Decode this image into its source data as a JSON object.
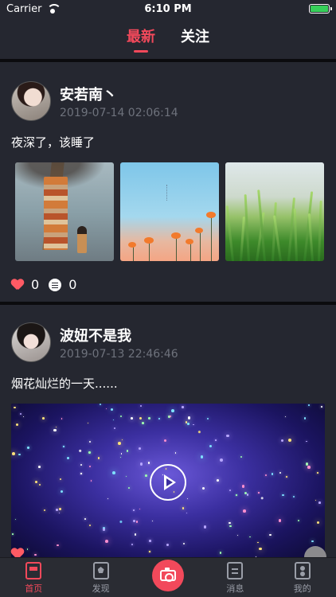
{
  "status_bar": {
    "carrier": "Carrier",
    "time": "6:10 PM"
  },
  "tabs": [
    {
      "label": "最新",
      "active": true
    },
    {
      "label": "关注",
      "active": false
    }
  ],
  "posts": [
    {
      "username": "安若南丶",
      "timestamp": "2019-07-14 02:06:14",
      "text": "夜深了，该睡了",
      "likes": "0",
      "comments": "0",
      "media": "images"
    },
    {
      "username": "波妞不是我",
      "timestamp": "2019-07-13 22:46:46",
      "text": "烟花灿烂的一天......",
      "media": "video"
    }
  ],
  "tab_bar": {
    "home": "首页",
    "discover": "发现",
    "messages": "消息",
    "mine": "我的"
  },
  "colors": {
    "accent": "#f2495b",
    "background": "#252730",
    "timestamp": "#6e727c",
    "like": "#ff5a64"
  }
}
